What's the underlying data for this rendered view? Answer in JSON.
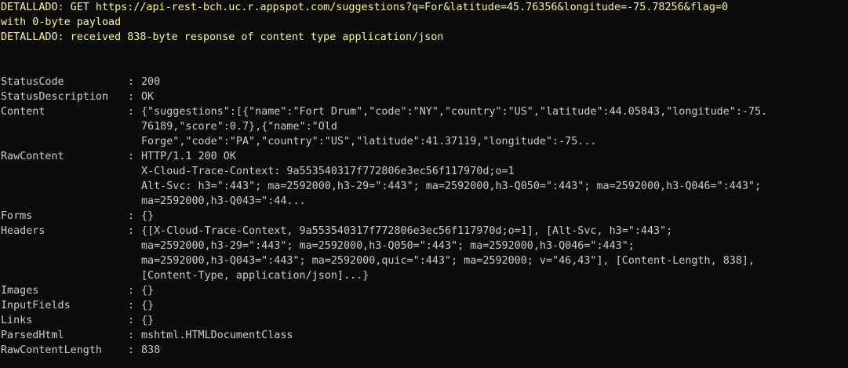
{
  "verbose": [
    "DETALLADO: GET https://api-rest-bch.uc.r.appspot.com/suggestions?q=For&latitude=45.76356&longitude=-75.78256&flag=0",
    "with 0-byte payload",
    "DETALLADO: received 838-byte response of content type application/json"
  ],
  "separator": ": ",
  "properties": [
    {
      "key": "StatusCode",
      "lines": [
        "200"
      ]
    },
    {
      "key": "StatusDescription",
      "lines": [
        "OK"
      ]
    },
    {
      "key": "Content",
      "lines": [
        "{\"suggestions\":[{\"name\":\"Fort Drum\",\"code\":\"NY\",\"country\":\"US\",\"latitude\":44.05843,\"longitude\":-75.",
        "76189,\"score\":0.7},{\"name\":\"Old",
        "Forge\",\"code\":\"PA\",\"country\":\"US\",\"latitude\":41.37119,\"longitude\":-75..."
      ]
    },
    {
      "key": "RawContent",
      "lines": [
        "HTTP/1.1 200 OK",
        "X-Cloud-Trace-Context: 9a553540317f772806e3ec56f117970d;o=1",
        "Alt-Svc: h3=\":443\"; ma=2592000,h3-29=\":443\"; ma=2592000,h3-Q050=\":443\"; ma=2592000,h3-Q046=\":443\";",
        "ma=2592000,h3-Q043=\":44..."
      ]
    },
    {
      "key": "Forms",
      "lines": [
        "{}"
      ]
    },
    {
      "key": "Headers",
      "lines": [
        "{[X-Cloud-Trace-Context, 9a553540317f772806e3ec56f117970d;o=1], [Alt-Svc, h3=\":443\";",
        "ma=2592000,h3-29=\":443\"; ma=2592000,h3-Q050=\":443\"; ma=2592000,h3-Q046=\":443\";",
        "ma=2592000,h3-Q043=\":443\"; ma=2592000,quic=\":443\"; ma=2592000; v=\"46,43\"], [Content-Length, 838],",
        "[Content-Type, application/json]...}"
      ]
    },
    {
      "key": "Images",
      "lines": [
        "{}"
      ]
    },
    {
      "key": "InputFields",
      "lines": [
        "{}"
      ]
    },
    {
      "key": "Links",
      "lines": [
        "{}"
      ]
    },
    {
      "key": "ParsedHtml",
      "lines": [
        "mshtml.HTMLDocumentClass"
      ]
    },
    {
      "key": "RawContentLength",
      "lines": [
        "838"
      ]
    }
  ],
  "colors": {
    "background": "#0c0c0c",
    "text": "#cccccc",
    "verbose": "#f9f1a5"
  }
}
